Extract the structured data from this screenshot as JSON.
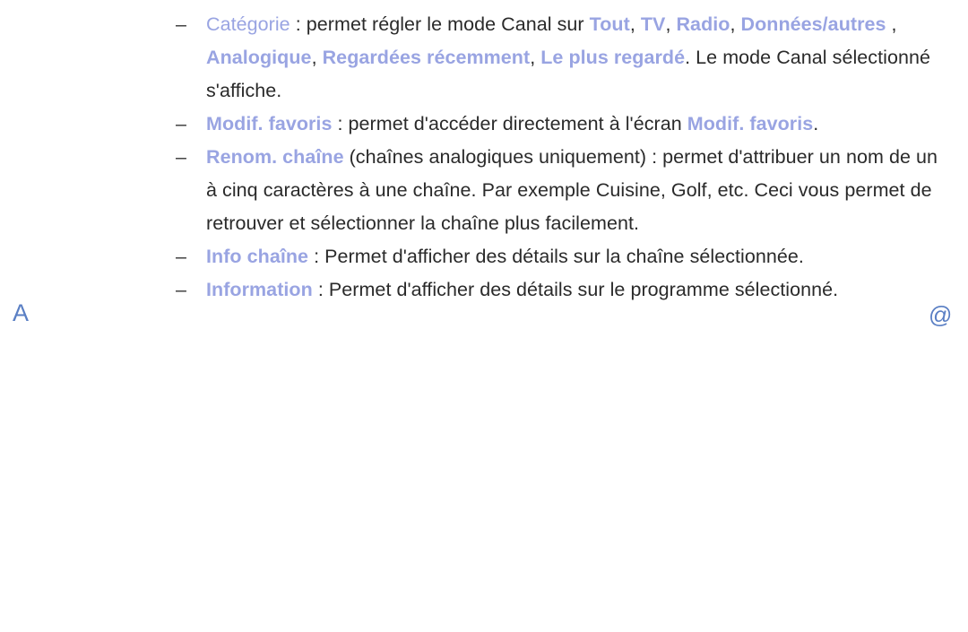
{
  "page": {
    "language": "fr",
    "background_color": "#ffffff",
    "body_text_color": "#2a2a2a",
    "highlight_color": "#99a4e2",
    "marker_color": "#5a7fc4"
  },
  "markers": {
    "left_marker": "A",
    "left_marker_name": "section-letter-marker",
    "right_icon": "@",
    "right_icon_name": "at-sign-icon"
  },
  "bullets": {
    "dash": "–"
  },
  "items": [
    {
      "id": "categorie",
      "term": "Catégorie",
      "term_bold": false,
      "segments": [
        {
          "text": "Catégorie",
          "style": "term-light"
        },
        {
          "text": " : permet régler le mode Canal sur ",
          "style": "plain"
        },
        {
          "text": "Tout",
          "style": "term"
        },
        {
          "text": ", ",
          "style": "plain"
        },
        {
          "text": "TV",
          "style": "term"
        },
        {
          "text": ", ",
          "style": "plain"
        },
        {
          "text": "Radio",
          "style": "term"
        },
        {
          "text": ", ",
          "style": "plain"
        },
        {
          "text": "Données/autres",
          "style": "term"
        },
        {
          "text": " , ",
          "style": "plain"
        },
        {
          "text": "Analogique",
          "style": "term"
        },
        {
          "text": ", ",
          "style": "plain"
        },
        {
          "text": "Regardées récemment",
          "style": "term"
        },
        {
          "text": ", ",
          "style": "plain"
        },
        {
          "text": "Le plus regardé",
          "style": "term"
        },
        {
          "text": ". Le mode Canal sélectionné s'affiche.",
          "style": "plain"
        }
      ]
    },
    {
      "id": "modif-favoris",
      "term": "Modif. favoris",
      "term_bold": true,
      "segments": [
        {
          "text": "Modif. favoris",
          "style": "term"
        },
        {
          "text": " : permet d'accéder directement à l'écran ",
          "style": "plain"
        },
        {
          "text": "Modif. favoris",
          "style": "term"
        },
        {
          "text": ".",
          "style": "plain"
        }
      ]
    },
    {
      "id": "renom-chaine",
      "term": "Renom. chaîne",
      "term_bold": true,
      "segments": [
        {
          "text": "Renom. chaîne",
          "style": "term"
        },
        {
          "text": " (chaînes analogiques uniquement) : permet d'attribuer un nom de un à cinq caractères à une chaîne. Par exemple Cuisine, Golf, etc. Ceci vous permet de retrouver et sélectionner la chaîne plus facilement.",
          "style": "plain"
        }
      ]
    },
    {
      "id": "info-chaine",
      "term": "Info chaîne",
      "term_bold": true,
      "segments": [
        {
          "text": "Info chaîne",
          "style": "term"
        },
        {
          "text": " : Permet d'afficher des détails sur la chaîne sélectionnée.",
          "style": "plain"
        }
      ]
    },
    {
      "id": "information",
      "term": "Information",
      "term_bold": true,
      "segments": [
        {
          "text": "Information",
          "style": "term"
        },
        {
          "text": " : Permet d'afficher des détails sur le programme sélectionné.",
          "style": "plain"
        }
      ]
    }
  ]
}
